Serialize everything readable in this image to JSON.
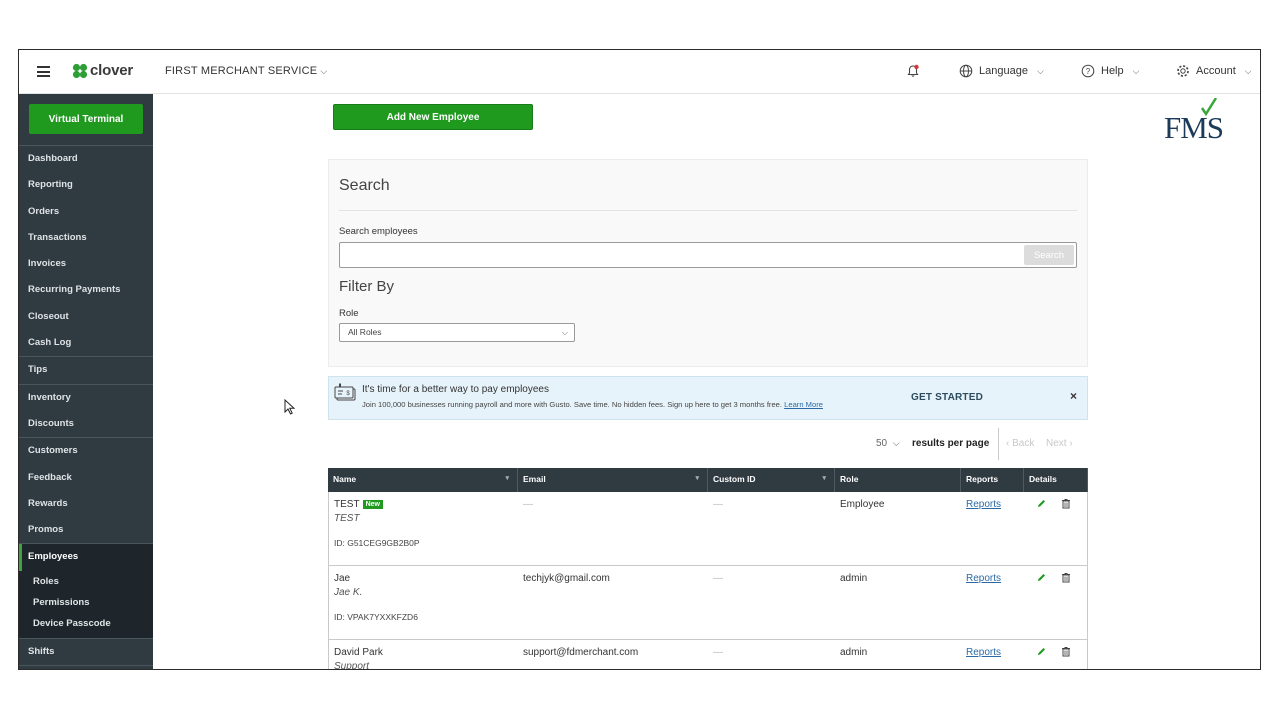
{
  "header": {
    "brand": "clover",
    "merchant": "FIRST MERCHANT SERVICE",
    "language_label": "Language",
    "help_label": "Help",
    "account_label": "Account"
  },
  "sidebar": {
    "virtual_terminal": "Virtual Terminal",
    "groups": [
      [
        "Dashboard",
        "Reporting",
        "Orders",
        "Transactions",
        "Invoices",
        "Recurring Payments",
        "Closeout",
        "Cash Log"
      ],
      [
        "Tips"
      ],
      [
        "Inventory",
        "Discounts"
      ],
      [
        "Customers",
        "Feedback",
        "Rewards",
        "Promos"
      ]
    ],
    "active_item": "Employees",
    "sub_items": [
      "Roles",
      "Permissions",
      "Device Passcode"
    ],
    "after_items": [
      "Shifts"
    ]
  },
  "main": {
    "add_button": "Add New Employee",
    "logo_text": "FMS",
    "search": {
      "title": "Search",
      "label": "Search employees",
      "value": "",
      "placeholder": "",
      "button": "Search"
    },
    "filter": {
      "title": "Filter By",
      "role_label": "Role",
      "role_value": "All Roles"
    },
    "banner": {
      "headline": "It's time for a better way to pay employees",
      "sub": "Join 100,000 businesses running payroll and more with Gusto. Save time. No hidden fees. Sign up here to get 3 months free.",
      "learn_more": "Learn More",
      "cta": "GET STARTED",
      "close": "×"
    },
    "pager": {
      "per_page": "50",
      "per_page_label": "results per page",
      "back": "‹ Back",
      "next": "Next ›"
    },
    "table": {
      "columns": [
        "Name",
        "Email",
        "Custom ID",
        "Role",
        "Reports",
        "Details"
      ],
      "rows": [
        {
          "name": "TEST",
          "badge": "New",
          "nickname": "TEST",
          "id": "ID: G51CEG9GB2B0P",
          "email": "—",
          "custom_id": "—",
          "role": "Employee",
          "reports": "Reports"
        },
        {
          "name": "Jae",
          "badge": "",
          "nickname": "Jae K.",
          "id": "ID: VPAK7YXXKFZD6",
          "email": "techjyk@gmail.com",
          "custom_id": "—",
          "role": "admin",
          "reports": "Reports"
        },
        {
          "name": "David Park",
          "badge": "",
          "nickname": "Support",
          "id": "",
          "email": "support@fdmerchant.com",
          "custom_id": "—",
          "role": "admin",
          "reports": "Reports"
        }
      ]
    }
  },
  "colors": {
    "primary_green": "#1f9a1f",
    "sidebar_bg": "#2f3a41",
    "link_blue": "#2b6aa6",
    "banner_bg": "#e7f3fa"
  },
  "icons": [
    "hamburger-icon",
    "clover-logo-icon",
    "bell-icon",
    "globe-icon",
    "help-icon",
    "gear-icon",
    "payroll-icon",
    "pencil-icon",
    "trash-icon"
  ]
}
